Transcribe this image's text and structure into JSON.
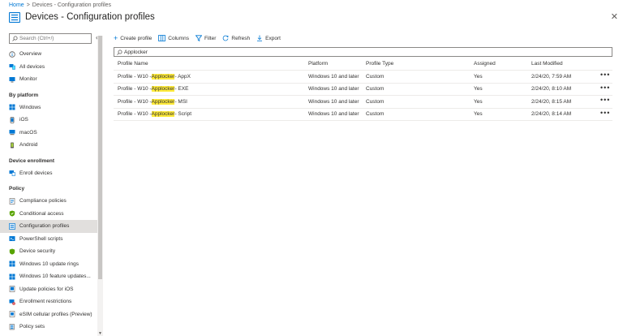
{
  "breadcrumb": {
    "home": "Home",
    "sep": ">",
    "current": "Devices - Configuration profiles"
  },
  "title": "Devices - Configuration profiles",
  "sidebar": {
    "search_placeholder": "Search (Ctrl+/)",
    "top_items": [
      {
        "label": "Overview",
        "icon": "overview-icon"
      },
      {
        "label": "All devices",
        "icon": "all-devices-icon"
      },
      {
        "label": "Monitor",
        "icon": "monitor-icon"
      }
    ],
    "sections": [
      {
        "title": "By platform",
        "items": [
          {
            "label": "Windows",
            "icon": "windows-icon"
          },
          {
            "label": "iOS",
            "icon": "ios-icon"
          },
          {
            "label": "macOS",
            "icon": "macos-icon"
          },
          {
            "label": "Android",
            "icon": "android-icon"
          }
        ]
      },
      {
        "title": "Device enrollment",
        "items": [
          {
            "label": "Enroll devices",
            "icon": "enroll-devices-icon"
          }
        ]
      },
      {
        "title": "Policy",
        "items": [
          {
            "label": "Compliance policies",
            "icon": "compliance-icon"
          },
          {
            "label": "Conditional access",
            "icon": "conditional-access-icon"
          },
          {
            "label": "Configuration profiles",
            "icon": "configuration-profiles-icon",
            "active": true
          },
          {
            "label": "PowerShell scripts",
            "icon": "powershell-icon"
          },
          {
            "label": "Device security",
            "icon": "device-security-icon"
          },
          {
            "label": "Windows 10 update rings",
            "icon": "update-rings-icon"
          },
          {
            "label": "Windows 10 feature updates...",
            "icon": "feature-updates-icon"
          },
          {
            "label": "Update policies for iOS",
            "icon": "ios-update-icon"
          },
          {
            "label": "Enrollment restrictions",
            "icon": "enrollment-restrictions-icon"
          },
          {
            "label": "eSIM cellular profiles (Preview)",
            "icon": "esim-icon"
          },
          {
            "label": "Policy sets",
            "icon": "policy-sets-icon"
          }
        ]
      }
    ]
  },
  "toolbar": {
    "create": "Create profile",
    "columns": "Columns",
    "filter": "Filter",
    "refresh": "Refresh",
    "export": "Export"
  },
  "filter_value": "Applocker",
  "table": {
    "headers": {
      "name": "Profile Name",
      "platform": "Platform",
      "type": "Profile Type",
      "assigned": "Assigned",
      "modified": "Last Modified"
    },
    "rows": [
      {
        "name_prefix": "Profile - W10 - ",
        "name_match": "Applocker",
        "name_suffix": " - AppX",
        "platform": "Windows 10 and later",
        "type": "Custom",
        "assigned": "Yes",
        "modified": "2/24/20, 7:59 AM"
      },
      {
        "name_prefix": "Profile - W10 - ",
        "name_match": "Applocker",
        "name_suffix": " - EXE",
        "platform": "Windows 10 and later",
        "type": "Custom",
        "assigned": "Yes",
        "modified": "2/24/20, 8:10 AM"
      },
      {
        "name_prefix": "Profile - W10 - ",
        "name_match": "Applocker",
        "name_suffix": " - MSI",
        "platform": "Windows 10 and later",
        "type": "Custom",
        "assigned": "Yes",
        "modified": "2/24/20, 8:15 AM"
      },
      {
        "name_prefix": "Profile - W10 - ",
        "name_match": "Applocker",
        "name_suffix": " - Script",
        "platform": "Windows 10 and later",
        "type": "Custom",
        "assigned": "Yes",
        "modified": "2/24/20, 8:14 AM"
      }
    ],
    "more_glyph": "•••"
  }
}
